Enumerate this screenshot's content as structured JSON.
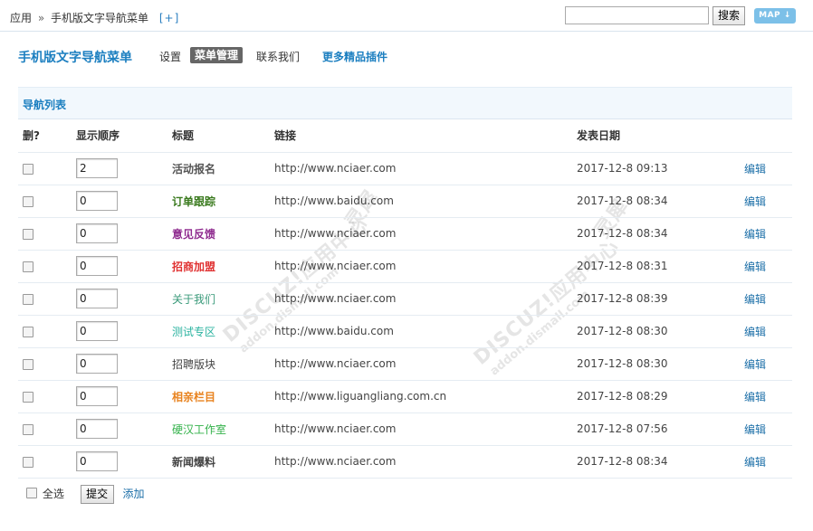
{
  "topbar": {
    "crumb_app": "应用",
    "crumb_sep": "»",
    "crumb_plugin": "手机版文字导航菜单",
    "crumb_add": "[+]",
    "search_value": "",
    "search_button": "搜索",
    "map_button": "MAP ↓"
  },
  "subnav": {
    "plugin_title": "手机版文字导航菜单",
    "tabs": [
      {
        "label": "设置"
      },
      {
        "label": "菜单管理"
      },
      {
        "label": "联系我们"
      },
      {
        "label": "更多精品插件"
      }
    ]
  },
  "panel": {
    "title": "导航列表",
    "columns": {
      "delete": "删?",
      "order": "显示顺序",
      "title": "标题",
      "link": "链接",
      "date": "发表日期",
      "edit": ""
    },
    "rows": [
      {
        "order": "2",
        "title": "活动报名",
        "title_color": "#555555",
        "bold": true,
        "link": "http://www.nciaer.com",
        "date": "2017-12-8 09:13",
        "edit": "编辑"
      },
      {
        "order": "0",
        "title": "订单跟踪",
        "title_color": "#3a7a1e",
        "bold": true,
        "link": "http://www.baidu.com",
        "date": "2017-12-8 08:34",
        "edit": "编辑"
      },
      {
        "order": "0",
        "title": "意见反馈",
        "title_color": "#8e2a8e",
        "bold": true,
        "link": "http://www.nciaer.com",
        "date": "2017-12-8 08:34",
        "edit": "编辑"
      },
      {
        "order": "0",
        "title": "招商加盟",
        "title_color": "#e03232",
        "bold": true,
        "link": "http://www.nciaer.com",
        "date": "2017-12-8 08:31",
        "edit": "编辑"
      },
      {
        "order": "0",
        "title": "关于我们",
        "title_color": "#3a9a7a",
        "bold": false,
        "link": "http://www.nciaer.com",
        "date": "2017-12-8 08:39",
        "edit": "编辑"
      },
      {
        "order": "0",
        "title": "测试专区",
        "title_color": "#2bb3a0",
        "bold": false,
        "link": "http://www.baidu.com",
        "date": "2017-12-8 08:30",
        "edit": "编辑"
      },
      {
        "order": "0",
        "title": "招聘版块",
        "title_color": "#444444",
        "bold": false,
        "link": "http://www.nciaer.com",
        "date": "2017-12-8 08:30",
        "edit": "编辑"
      },
      {
        "order": "0",
        "title": "相亲栏目",
        "title_color": "#e8821e",
        "bold": true,
        "link": "http://www.liguangliang.com.cn",
        "date": "2017-12-8 08:29",
        "edit": "编辑"
      },
      {
        "order": "0",
        "title": "硬汉工作室",
        "title_color": "#33b24a",
        "bold": false,
        "link": "http://www.nciaer.com",
        "date": "2017-12-8 07:56",
        "edit": "编辑"
      },
      {
        "order": "0",
        "title": "新闻爆料",
        "title_color": "#444444",
        "bold": true,
        "link": "http://www.nciaer.com",
        "date": "2017-12-8 08:34",
        "edit": "编辑"
      }
    ]
  },
  "footer": {
    "select_all": "全选",
    "submit": "提交",
    "add": "添加"
  },
  "watermarks": {
    "main": "DISCUZ!应用中心",
    "sub": "addon.dismall.com",
    "tail": "灵犀"
  },
  "colors": {
    "link_blue": "#1c7fc0",
    "panel_bg": "#f2f8fd",
    "map_button": "#7cc0e8",
    "active_tab": "#666666"
  }
}
